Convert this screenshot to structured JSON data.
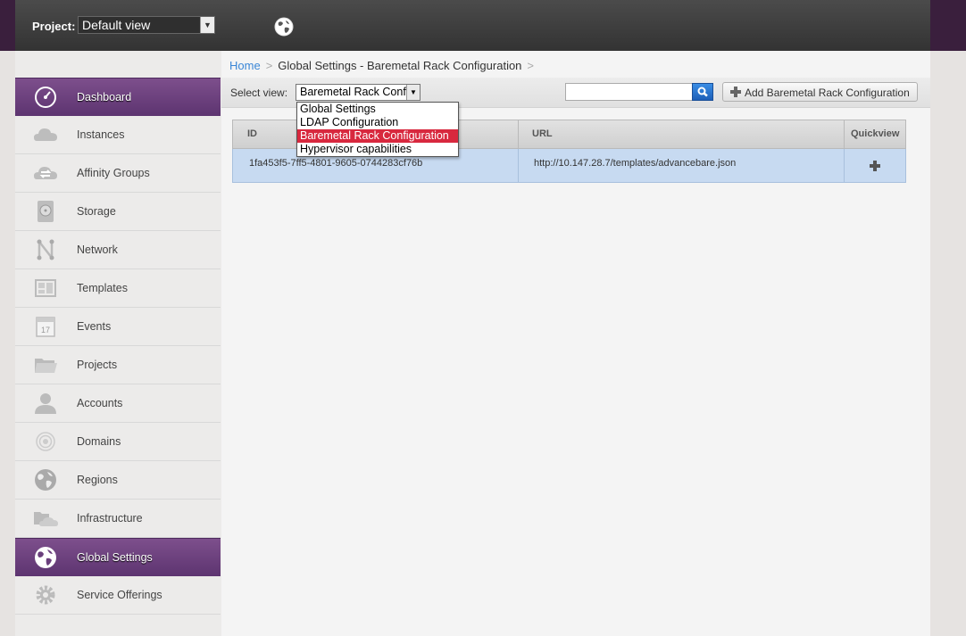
{
  "header": {
    "project_label": "Project:",
    "project_value": "Default view",
    "globe_icon": "globe-icon"
  },
  "sidebar": {
    "items": [
      {
        "label": "Dashboard",
        "icon": "dashboard-icon",
        "active": true
      },
      {
        "label": "Instances",
        "icon": "cloud-icon",
        "active": false
      },
      {
        "label": "Affinity Groups",
        "icon": "affinity-cloud-icon",
        "active": false
      },
      {
        "label": "Storage",
        "icon": "storage-icon",
        "active": false
      },
      {
        "label": "Network",
        "icon": "network-icon",
        "active": false
      },
      {
        "label": "Templates",
        "icon": "templates-icon",
        "active": false
      },
      {
        "label": "Events",
        "icon": "calendar-icon",
        "active": false
      },
      {
        "label": "Projects",
        "icon": "folder-icon",
        "active": false
      },
      {
        "label": "Accounts",
        "icon": "user-icon",
        "active": false
      },
      {
        "label": "Domains",
        "icon": "domains-icon",
        "active": false
      },
      {
        "label": "Regions",
        "icon": "globe-icon",
        "active": false
      },
      {
        "label": "Infrastructure",
        "icon": "infrastructure-icon",
        "active": false
      },
      {
        "label": "Global Settings",
        "icon": "globe-icon",
        "active": true
      },
      {
        "label": "Service Offerings",
        "icon": "gear-icon",
        "active": false
      }
    ],
    "events_date": "17"
  },
  "breadcrumb": {
    "home": "Home",
    "separator": ">",
    "current": "Global Settings - Baremetal Rack Configuration"
  },
  "toolbar": {
    "select_view_label": "Select view:",
    "select_view_value": "Baremetal Rack Conf",
    "search_placeholder": "",
    "add_button_label": "Add Baremetal Rack Configuration"
  },
  "dropdown": {
    "options": [
      {
        "label": "Global Settings",
        "selected": false
      },
      {
        "label": "LDAP Configuration",
        "selected": false
      },
      {
        "label": "Baremetal Rack Configuration",
        "selected": true
      },
      {
        "label": "Hypervisor capabilities",
        "selected": false
      }
    ]
  },
  "table": {
    "columns": [
      "ID",
      "URL",
      "Quickview"
    ],
    "rows": [
      {
        "id": "1fa453f5-7ff5-4801-9605-0744283cf76b",
        "url": "http://10.147.28.7/templates/advancebare.json"
      }
    ]
  },
  "colors": {
    "accent_purple": "#6a3f7c",
    "selected_option": "#d8283e",
    "link_blue": "#3a86d6",
    "row_highlight": "#c7daf1"
  }
}
